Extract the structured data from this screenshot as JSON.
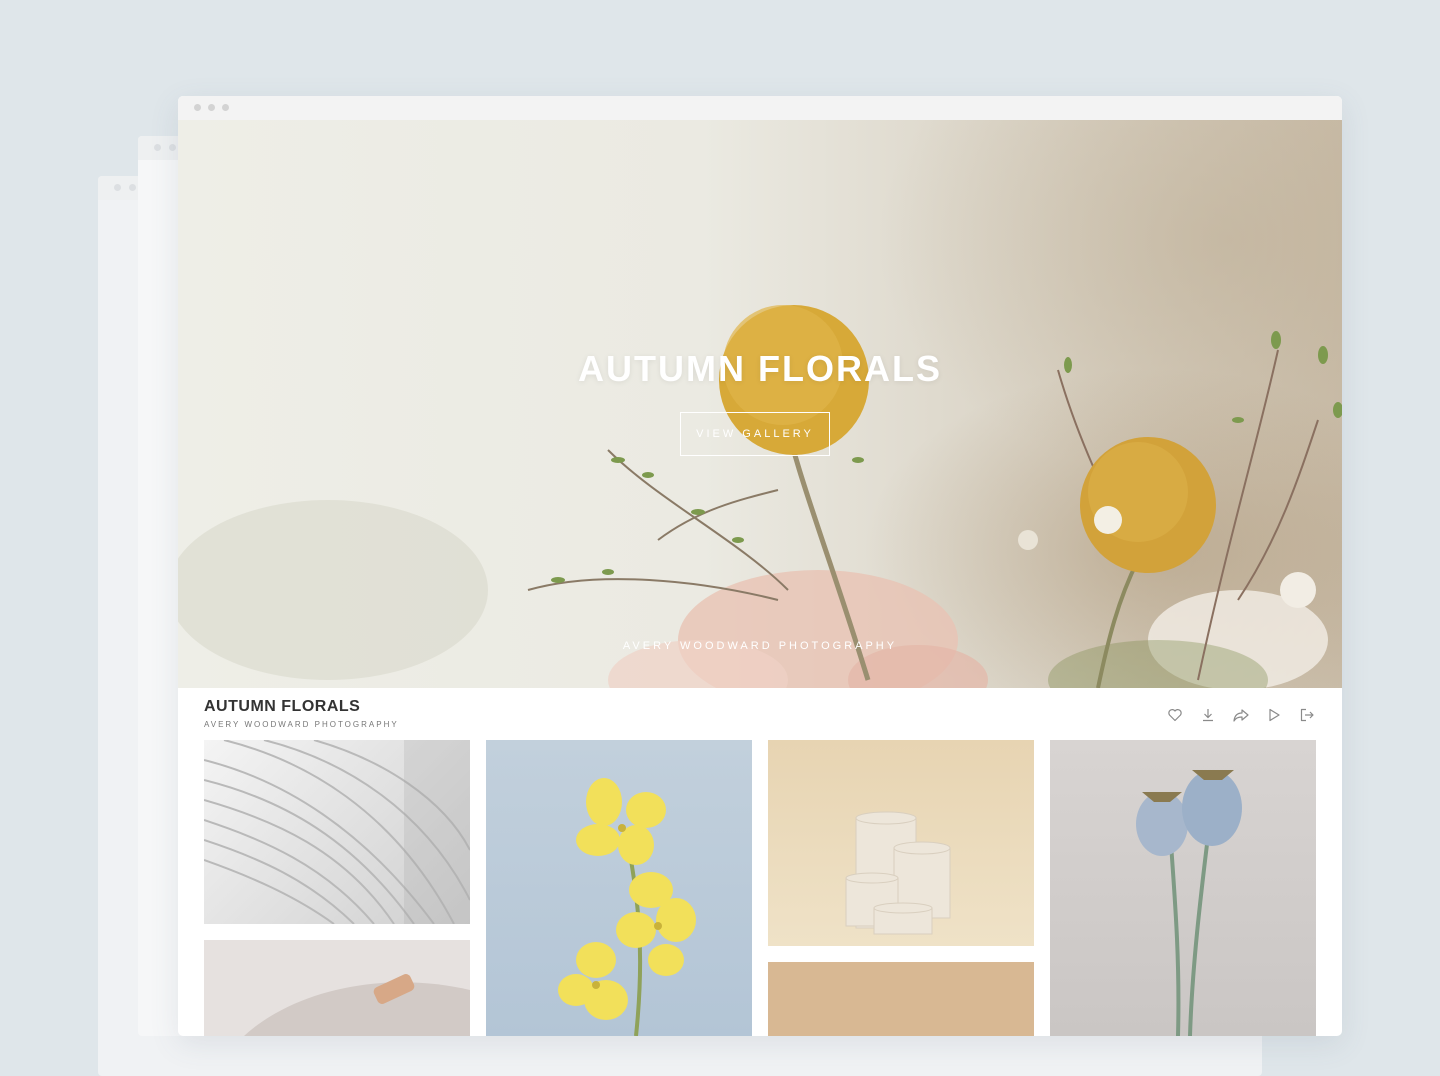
{
  "hero": {
    "title": "AUTUMN FLORALS",
    "button_label": "VIEW GALLERY",
    "subtitle": "AVERY WOODWARD PHOTOGRAPHY"
  },
  "gallery": {
    "title": "AUTUMN FLORALS",
    "subtitle": "AVERY WOODWARD PHOTOGRAPHY",
    "actions": [
      {
        "name": "favorite",
        "icon": "heart-icon"
      },
      {
        "name": "download",
        "icon": "download-icon"
      },
      {
        "name": "share",
        "icon": "share-icon"
      },
      {
        "name": "slideshow",
        "icon": "play-icon"
      },
      {
        "name": "exit",
        "icon": "exit-icon"
      }
    ],
    "photos": [
      {
        "subject": "white architecture"
      },
      {
        "subject": "yellow flowers"
      },
      {
        "subject": "white cylinders"
      },
      {
        "subject": "blue poppy pods"
      },
      {
        "subject": "brush on towel"
      },
      {
        "subject": "beige backdrop"
      }
    ]
  },
  "colors": {
    "background": "#dfe6ea",
    "hero_text": "#ffffff",
    "title_text": "#333333",
    "accent_yellow": "#d8ad3a"
  }
}
